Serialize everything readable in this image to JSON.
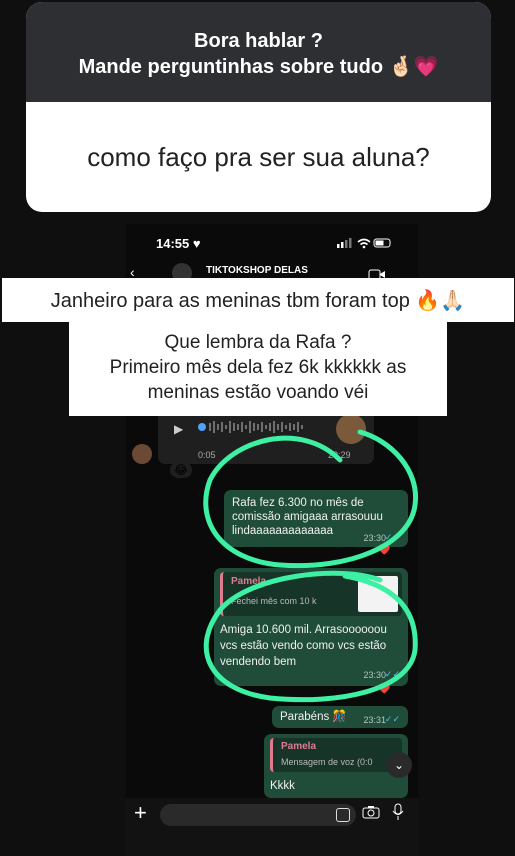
{
  "question": {
    "header_line1": "Bora hablar ?",
    "header_line2": "Mande perguntinhas sobre tudo 🤞🏻💗",
    "body": "como faço pra ser sua aluna?"
  },
  "status_bar": {
    "time": "14:55 ♥"
  },
  "chat_header": {
    "name": "TIKTOKSHOP DELAS"
  },
  "overlay": {
    "caption1": "Janheiro para as meninas tbm foram top 🔥🙏🏻",
    "caption2_line1": "Que lembra da Rafa ?",
    "caption2_line2": "Primeiro mês dela fez 6k kkkkkk as",
    "caption2_line3": "meninas estão voando véi"
  },
  "voice_message": {
    "duration": "0:05",
    "time": "23:29"
  },
  "reaction_emoji": "😂",
  "messages": [
    {
      "text": "Rafa fez   6.300 no mês de comissão amigaaa arrasouuu lindaaaaaaaaaaaaa",
      "time": "23:30",
      "reaction": "❤️"
    },
    {
      "quote_name": "Pamela",
      "quote_text": "Fechei mês com 10 k",
      "text": "Amiga 10.600 mil. Arrasoooooou vcs estão vendo como vcs estão vendendo bem",
      "time": "23:30",
      "reaction": "❤️"
    },
    {
      "text": "Parabéns 🎊",
      "time": "23:31"
    },
    {
      "quote_name": "Pamela",
      "quote_text": "Mensagem de voz (0:0",
      "text": "Kkkk"
    }
  ],
  "colors": {
    "outgoing_bubble": "#1f4d3a",
    "highlight_circle": "#3df0a4",
    "quote_bar": "#e07b8f"
  },
  "icons": [
    "plus-icon",
    "sticker-icon",
    "camera-icon",
    "mic-icon",
    "chevron-down-icon",
    "back-icon",
    "video-call-icon"
  ]
}
